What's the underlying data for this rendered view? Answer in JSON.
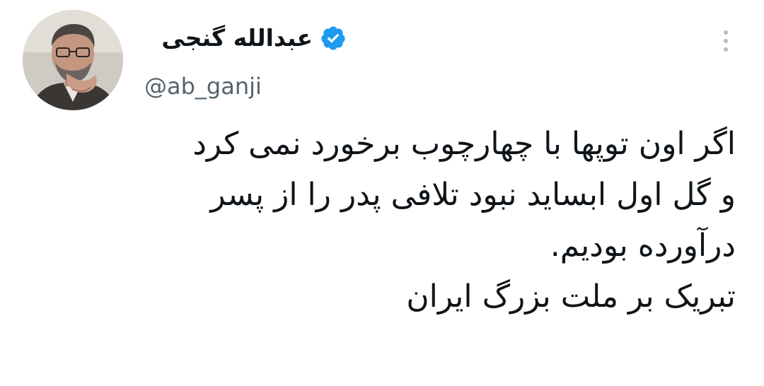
{
  "author": {
    "display_name": "عبدالله گنجی",
    "handle": "@ab_ganji",
    "verified_icon": "verified-badge-icon",
    "verified_color": "#1d9bf0"
  },
  "tweet": {
    "lines": [
      "اگر اون توپها با چهارچوب برخورد نمی کرد",
      "و گل اول ابساید نبود تلافی پدر را از پسر",
      "درآورده بودیم.",
      "تبریک بر ملت بزرگ ایران"
    ]
  },
  "menu": {
    "icon": "more-vertical-icon"
  }
}
